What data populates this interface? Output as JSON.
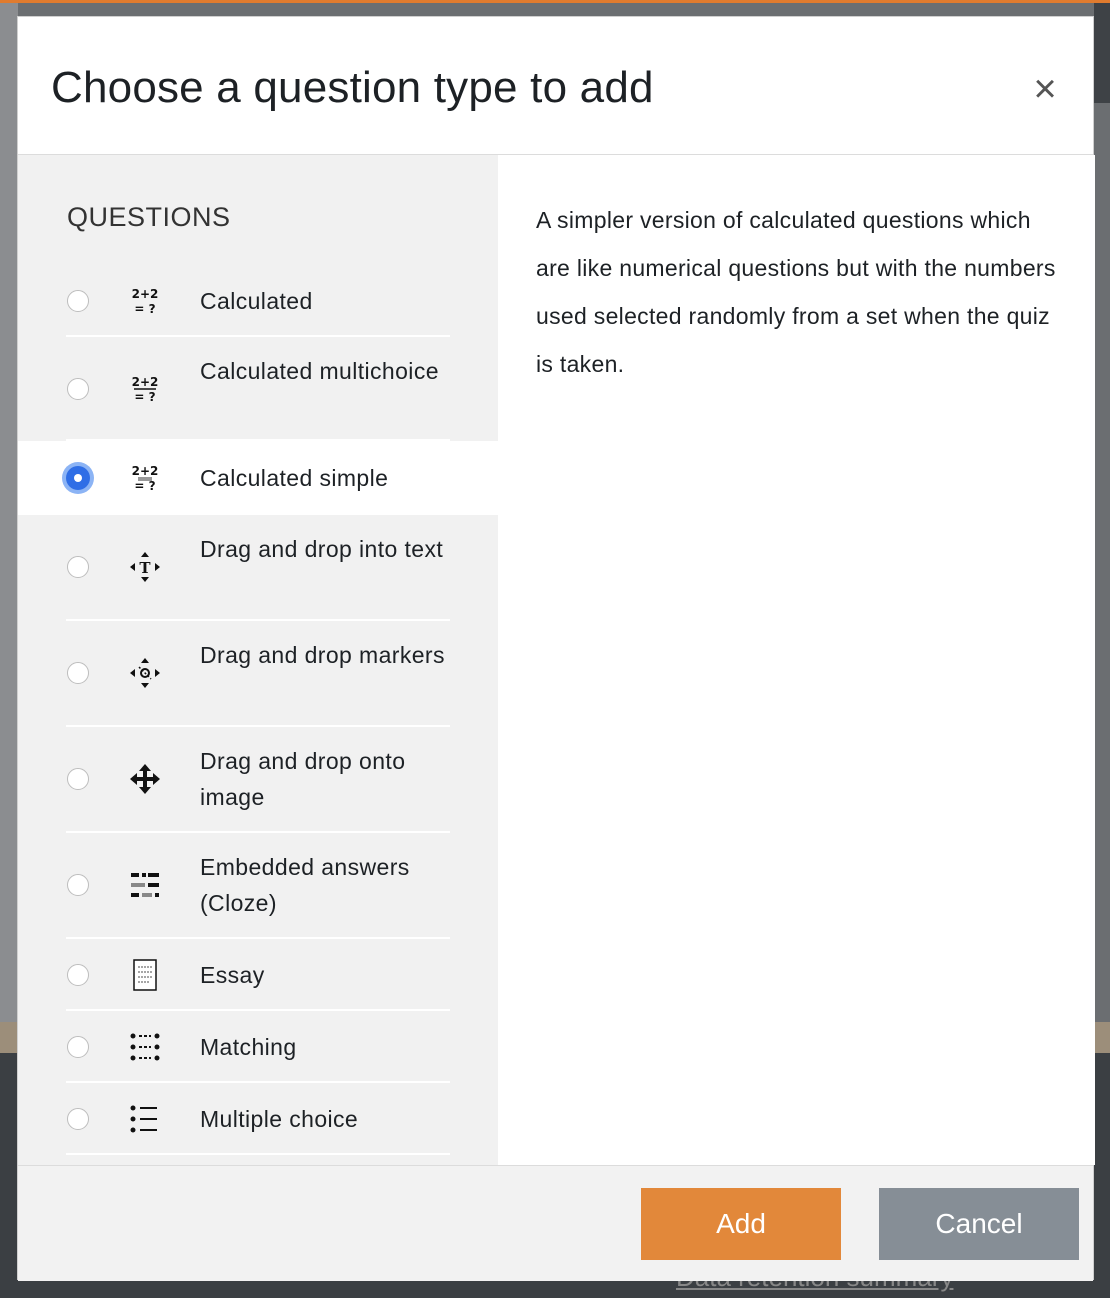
{
  "dialog": {
    "title": "Choose a question type to add",
    "close_symbol": "×"
  },
  "questions_heading": "QUESTIONS",
  "options": [
    {
      "label": "Calculated",
      "icon": "calculated-icon",
      "selected": false
    },
    {
      "label": "Calculated multichoice",
      "icon": "calculated-multichoice-icon",
      "selected": false
    },
    {
      "label": "Calculated simple",
      "icon": "calculated-simple-icon",
      "selected": true
    },
    {
      "label": "Drag and drop into text",
      "icon": "drag-drop-text-icon",
      "selected": false
    },
    {
      "label": "Drag and drop markers",
      "icon": "drag-drop-markers-icon",
      "selected": false
    },
    {
      "label": "Drag and drop onto image",
      "icon": "drag-drop-image-icon",
      "selected": false
    },
    {
      "label": "Embedded answers (Cloze)",
      "icon": "cloze-icon",
      "selected": false
    },
    {
      "label": "Essay",
      "icon": "essay-icon",
      "selected": false
    },
    {
      "label": "Matching",
      "icon": "matching-icon",
      "selected": false
    },
    {
      "label": "Multiple choice",
      "icon": "multiple-choice-icon",
      "selected": false
    }
  ],
  "description": "A simpler version of calculated questions which are like numerical questions but with the numbers used selected randomly from a set when the quiz is taken.",
  "buttons": {
    "add": "Add",
    "cancel": "Cancel"
  },
  "background": {
    "footer_link": "Data retention summary"
  },
  "colors": {
    "add_button": "#e2883a",
    "cancel_button": "#868e96",
    "radio_selected": "#2f6ee6",
    "top_accent": "#e07b2e"
  }
}
